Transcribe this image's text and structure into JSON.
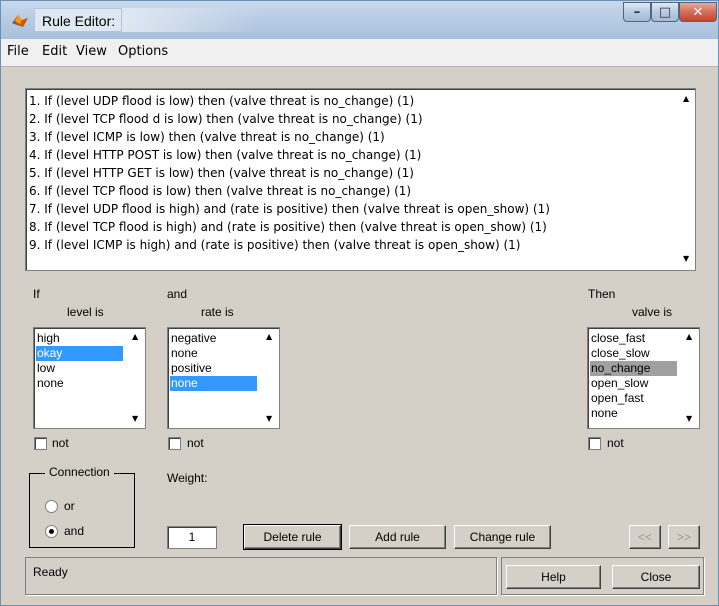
{
  "window": {
    "title": "Rule Editor:"
  },
  "menu": [
    "File",
    "Edit",
    "View",
    "Options"
  ],
  "rules": [
    "1. If (level UDP flood is low) then (valve threat  is no_change) (1)",
    "2. If (level TCP flood d is low) then (valve threat  is no_change) (1)",
    "3. If (level ICMP is low) then (valve threat is no_change) (1)",
    "4. If (level HTTP POST is low) then (valve threat  is no_change) (1)",
    "5. If (level HTTP GET is low) then (valve threat is no_change) (1)",
    "6. If (level TCP flood is low) then (valve threat is no_change) (1)",
    "7. If (level UDP flood is high) and (rate is positive) then (valve threat is open_show) (1)",
    "8. If (level TCP flood is high) and (rate is positive) then (valve threat  is open_show) (1)",
    "9. If (level ICMP is high) and (rate is positive) then (valve threat is open_show) (1)"
  ],
  "if_panel": {
    "header": "If",
    "sub": "level is",
    "options": [
      "high",
      "okay",
      "low",
      "none"
    ],
    "selected": "okay",
    "not_label": "not"
  },
  "and_panel": {
    "header": "and",
    "sub": "rate is",
    "options": [
      "negative",
      "none",
      "positive",
      "none"
    ],
    "selected_index": 3,
    "not_label": "not"
  },
  "then_panel": {
    "header": "Then",
    "sub": "valve is",
    "options": [
      "close_fast",
      "close_slow",
      "no_change",
      "open_slow",
      "open_fast",
      "none"
    ],
    "selected": "no_change",
    "not_label": "not"
  },
  "connection": {
    "label": "Connection",
    "options": [
      "or",
      "and"
    ],
    "selected": "and"
  },
  "weight": {
    "label": "Weight:",
    "value": "1"
  },
  "buttons": {
    "delete": "Delete rule",
    "add": "Add rule",
    "change": "Change rule",
    "prev": "<<",
    "next": ">>",
    "help": "Help",
    "close": "Close"
  },
  "status": "Ready",
  "colors": {
    "selection": "#3399ff",
    "inactive_selection": "#a0a0a0",
    "panel": "#d4d0c8"
  }
}
